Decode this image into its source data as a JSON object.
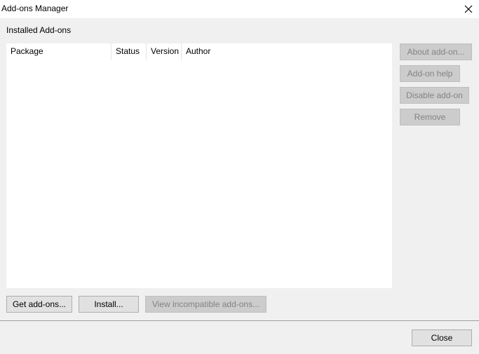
{
  "window": {
    "title": "Add-ons Manager"
  },
  "section_label": "Installed Add-ons",
  "table": {
    "columns": [
      "Package",
      "Status",
      "Version",
      "Author"
    ],
    "rows": []
  },
  "side_buttons": {
    "about": "About add-on...",
    "help": "Add-on help",
    "disable": "Disable add-on",
    "remove": "Remove"
  },
  "bottom_buttons": {
    "get": "Get add-ons...",
    "install": "Install...",
    "view_incompatible": "View incompatible add-ons..."
  },
  "footer": {
    "close": "Close"
  },
  "icons": {
    "close": "close-icon"
  }
}
